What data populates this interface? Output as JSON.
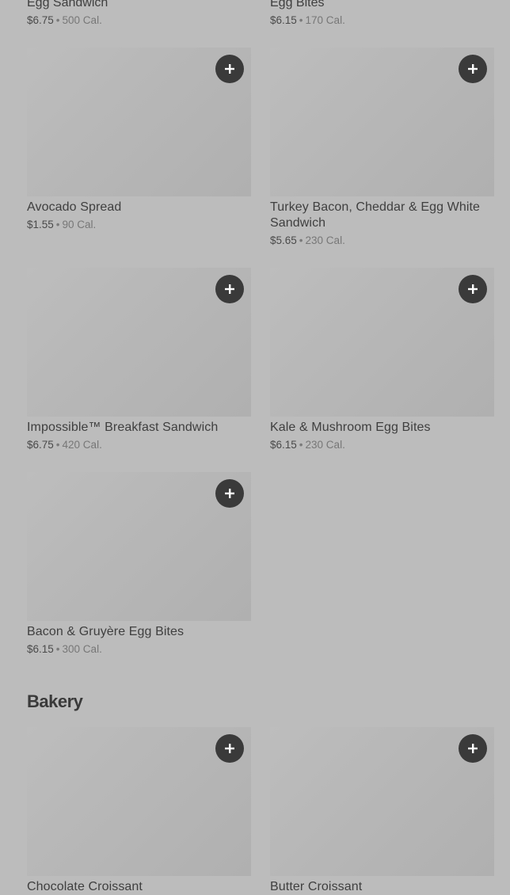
{
  "top_row": [
    {
      "name": "Egg Sandwich",
      "price": "$6.75",
      "calories": "500 Cal."
    },
    {
      "name": "Egg Bites",
      "price": "$6.15",
      "calories": "170 Cal."
    }
  ],
  "items": [
    {
      "name": "Avocado Spread",
      "price": "$1.55",
      "calories": "90 Cal."
    },
    {
      "name": "Turkey Bacon, Cheddar & Egg White Sandwich",
      "price": "$5.65",
      "calories": "230 Cal."
    },
    {
      "name": "Impossible™ Breakfast Sandwich",
      "price": "$6.75",
      "calories": "420 Cal."
    },
    {
      "name": "Kale & Mushroom Egg Bites",
      "price": "$6.15",
      "calories": "230 Cal."
    },
    {
      "name": "Bacon & Gruyère Egg Bites",
      "price": "$6.15",
      "calories": "300 Cal."
    }
  ],
  "bakery": {
    "title": "Bakery",
    "items": [
      {
        "name": "Chocolate Croissant"
      },
      {
        "name": "Butter Croissant"
      }
    ]
  },
  "separator": "•",
  "icons": {
    "add": "plus-icon"
  },
  "colors": {
    "background": "#bcbcbc",
    "add_button": "#3a3a3a",
    "text": "#3a3a3a"
  }
}
